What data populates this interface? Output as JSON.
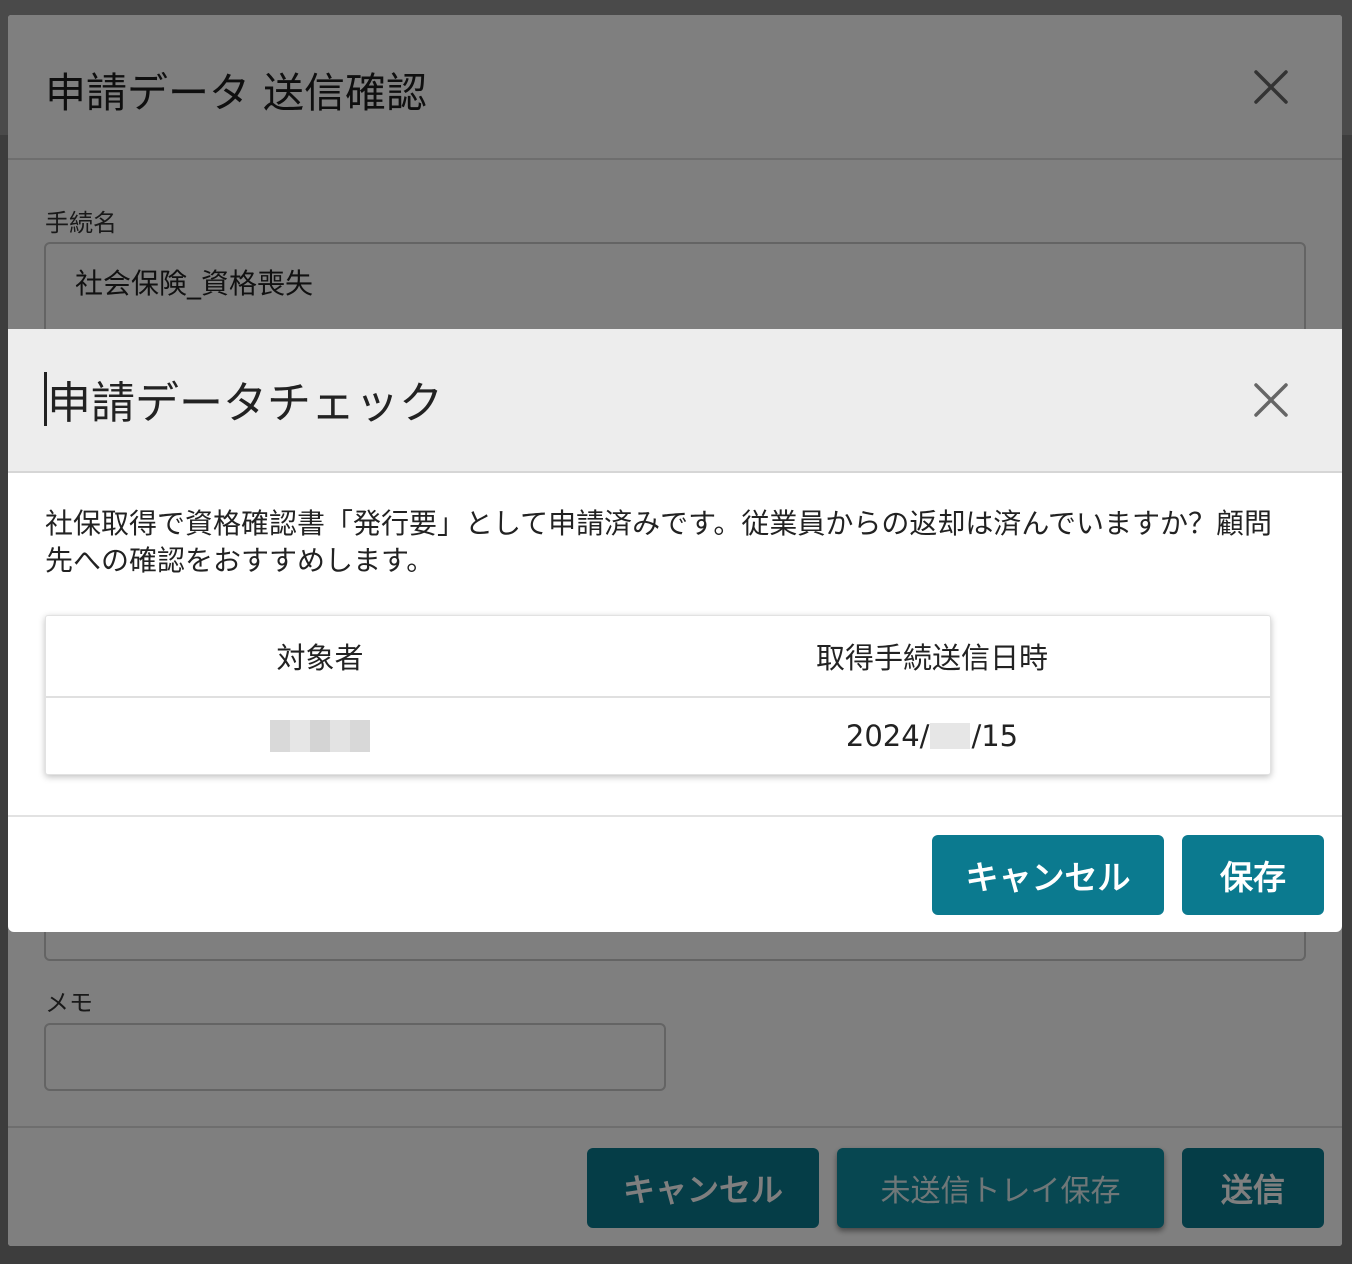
{
  "outer_dialog": {
    "title": "申請データ 送信確認",
    "procedure_label": "手続名",
    "procedure_value": "社会保険_資格喪失",
    "memo_label": "メモ",
    "memo_value": "",
    "buttons": {
      "cancel": "キャンセル",
      "save_to_tray": "未送信トレイ保存",
      "send": "送信"
    }
  },
  "check_dialog": {
    "title": "申請データチェック",
    "message": "社保取得で資格確認書「発行要」として申請済みです。従業員からの返却は済んでいますか？顧問先への確認をおすすめします。",
    "table": {
      "headers": [
        "対象者",
        "取得手続送信日時"
      ],
      "rows": [
        {
          "target_person": "",
          "date_prefix": "2024/",
          "date_suffix": "/15"
        }
      ]
    },
    "buttons": {
      "cancel": "キャンセル",
      "save": "保存"
    }
  },
  "colors": {
    "primary_button": "#0b7a8f",
    "header_bg": "#ededed",
    "overlay": "rgba(0,0,0,0.5)"
  },
  "icons": [
    "close-icon"
  ]
}
